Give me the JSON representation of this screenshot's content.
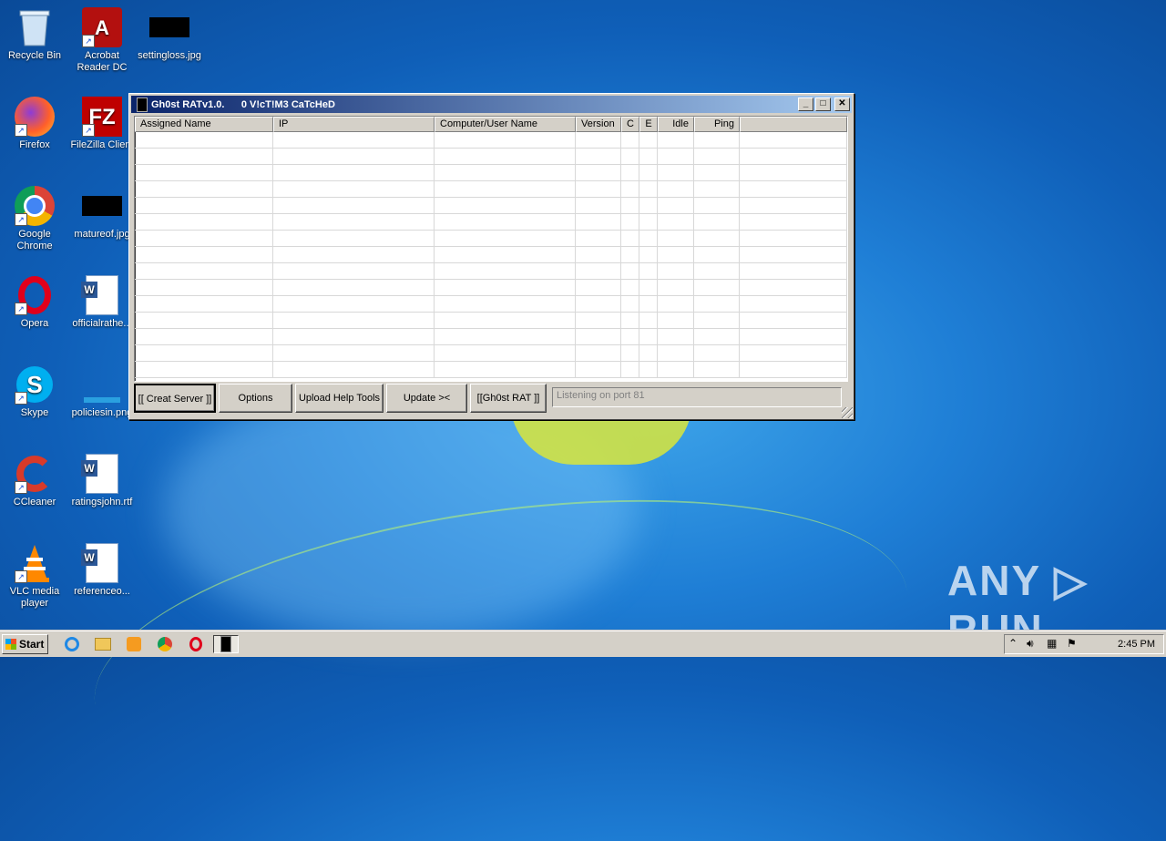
{
  "desktop": {
    "icons": [
      {
        "label": "Recycle Bin"
      },
      {
        "label": "Acrobat Reader DC"
      },
      {
        "label": "settingloss.jpg"
      },
      {
        "label": "Firefox"
      },
      {
        "label": "FileZilla Client"
      },
      {
        "label": "Google Chrome"
      },
      {
        "label": "matureof.jpg"
      },
      {
        "label": "Opera"
      },
      {
        "label": "officialrathe..."
      },
      {
        "label": "Skype"
      },
      {
        "label": "policiesin.png"
      },
      {
        "label": "CCleaner"
      },
      {
        "label": "ratingsjohn.rtf"
      },
      {
        "label": "VLC media player"
      },
      {
        "label": "referenceo..."
      }
    ],
    "watermark": "ANY ▷ RUN"
  },
  "window": {
    "title": "Gh0st RATv1.0.      0 V!cT!M3 CaTcHeD",
    "controls": {
      "minimize": "_",
      "maximize": "□",
      "close": "✕"
    },
    "columns": [
      {
        "label": "Assigned Name"
      },
      {
        "label": "IP"
      },
      {
        "label": "Computer/User Name"
      },
      {
        "label": "Version"
      },
      {
        "label": "C"
      },
      {
        "label": "E"
      },
      {
        "label": "Idle"
      },
      {
        "label": "Ping"
      },
      {
        "label": ""
      }
    ],
    "buttons": {
      "create_server": "[[ Creat Server ]]",
      "options": "Options",
      "upload_help": "Upload Help Tools",
      "update": "Update ><",
      "ghost_rat": "[[Gh0st RAT ]]"
    },
    "status": "Listening on port 81"
  },
  "taskbar": {
    "start_label": "Start",
    "clock": "2:45 PM"
  }
}
